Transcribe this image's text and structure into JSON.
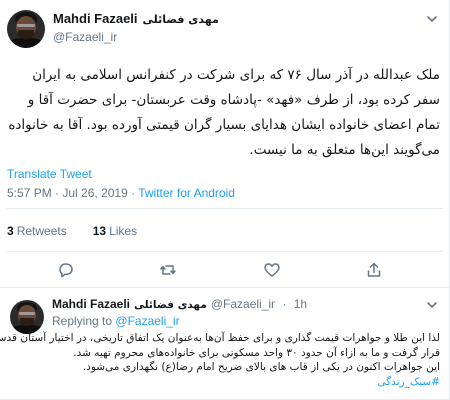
{
  "main_tweet": {
    "author_name": "Mahdi Fazaeli",
    "author_name_fa": "مهدی فضائلی",
    "handle": "@Fazaeli_ir",
    "text_lines": [
      "ملک عبدالله در آذر سال ۷۶ که برای شرکت در کنفرانس اسلامی به ایران",
      "سفر کرده بود، از طرف «فهد» -پادشاه وقت عربستان- برای حضرت آقا و",
      "تمام اعضای خانواده ایشان هدایای بسیار گران قیمتی آورده بود. آقا به خانواده",
      "می‌گویند این‌ها متعلق به ما نیست."
    ],
    "translate_label": "Translate Tweet",
    "time": "5:57 PM",
    "date": "Jul 26, 2019",
    "source": "Twitter for Android",
    "retweets_count": "3",
    "retweets_label": "Retweets",
    "likes_count": "13",
    "likes_label": "Likes"
  },
  "reply_tweet": {
    "author_name": "Mahdi Fazaeli",
    "author_name_fa": "مهدی فضائلی",
    "handle": "@Fazaeli_ir",
    "time_ago": "1h",
    "replying_label": "Replying to",
    "replying_to": "@Fazaeli_ir",
    "text_lines": [
      "لذا این طلا و جواهرات قیمت گذاری و برای حفظ آن‌ها به‌عنوان یک اتفاق تاریخی، در اختیار آستان قدس",
      "قرار گرفت و ما به ازاء آن حدود ۳۰ واحد مسکونی برای خانواده‌های محروم تهیه شد.",
      "این جواهرات اکنون در یکی از قاب های بالای ضریح امام رضا(ع) نگهداری می‌شود."
    ],
    "hashtag": "#سبک_زندگی"
  },
  "icons": {
    "chevron": "chevron-down-icon",
    "reply": "reply-icon",
    "retweet": "retweet-icon",
    "like": "heart-icon",
    "share": "share-icon"
  },
  "colors": {
    "link": "#1da1f2",
    "muted": "#657786",
    "text": "#14171a",
    "border": "#e6ecf0"
  }
}
